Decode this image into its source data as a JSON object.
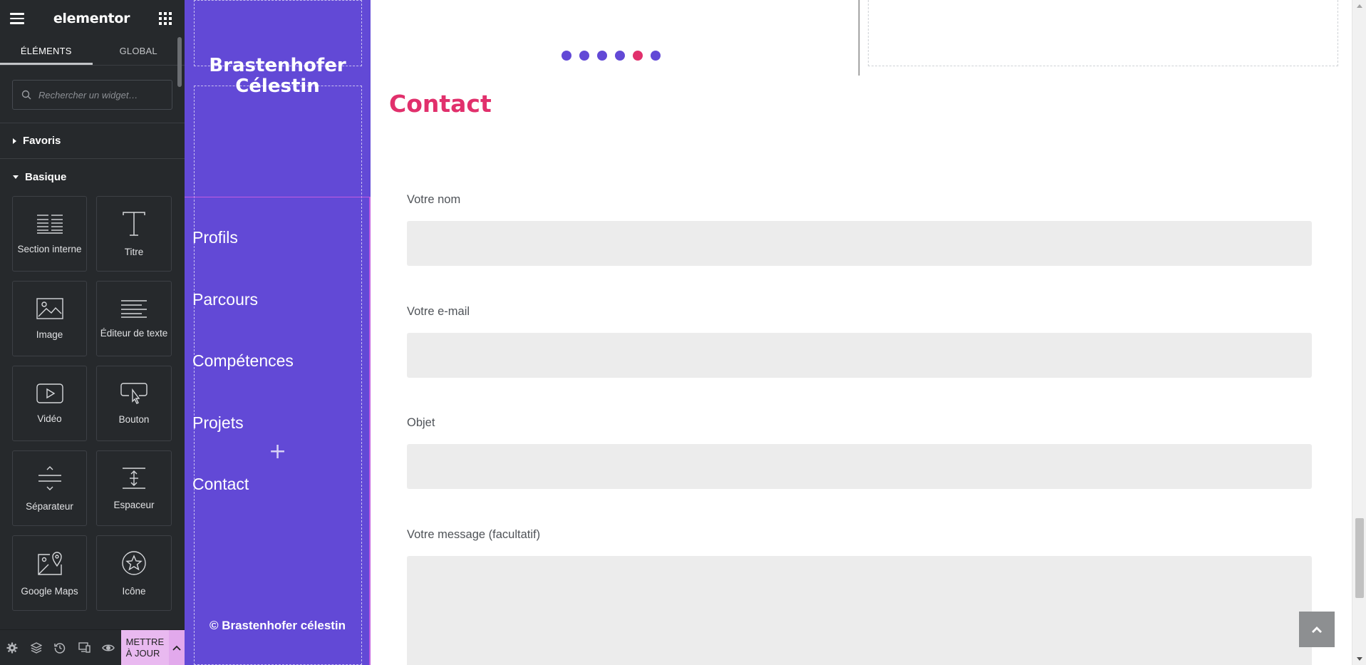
{
  "panel": {
    "title": "elementor",
    "tabs": [
      {
        "label": "ÉLÉMENTS",
        "active": true
      },
      {
        "label": "GLOBAL",
        "active": false
      }
    ],
    "search": {
      "placeholder": "Rechercher un widget…"
    },
    "categories": {
      "favorites": "Favoris",
      "basic": "Basique"
    },
    "widgets": [
      {
        "label": "Section interne",
        "icon": "inner-section-icon"
      },
      {
        "label": "Titre",
        "icon": "heading-icon"
      },
      {
        "label": "Image",
        "icon": "image-icon"
      },
      {
        "label": "Éditeur de texte",
        "icon": "text-editor-icon"
      },
      {
        "label": "Vidéo",
        "icon": "video-icon"
      },
      {
        "label": "Bouton",
        "icon": "button-icon"
      },
      {
        "label": "Séparateur",
        "icon": "divider-icon"
      },
      {
        "label": "Espaceur",
        "icon": "spacer-icon"
      },
      {
        "label": "Google Maps",
        "icon": "google-maps-icon"
      },
      {
        "label": "Icône",
        "icon": "star-icon"
      }
    ],
    "footer": {
      "icons": [
        "settings-icon",
        "navigator-icon",
        "history-icon",
        "responsive-icon",
        "preview-eye-icon"
      ],
      "update_line1": "METTRE",
      "update_line2": "À JOUR",
      "update_color": "#e9b9f0"
    },
    "colors": {
      "bg": "#26292c",
      "text": "#e0e1e3"
    }
  },
  "site": {
    "name_line1": "Brastenhofer",
    "name_line2": "Célestin",
    "nav": [
      "Profils",
      "Parcours",
      "Compétences",
      "Projets",
      "Contact"
    ],
    "copyright": "© Brastenhofer célestin",
    "sidebar_color": "#6249d6",
    "accent_color": "#e1306c"
  },
  "main": {
    "slider_dots": {
      "count": 6,
      "active_index": 4
    },
    "contact_heading": "Contact",
    "form": {
      "name_label": "Votre nom",
      "email_label": "Votre e-mail",
      "subject_label": "Objet",
      "message_label": "Votre message (facultatif)",
      "name_value": "",
      "email_value": "",
      "subject_value": "",
      "message_value": ""
    }
  }
}
